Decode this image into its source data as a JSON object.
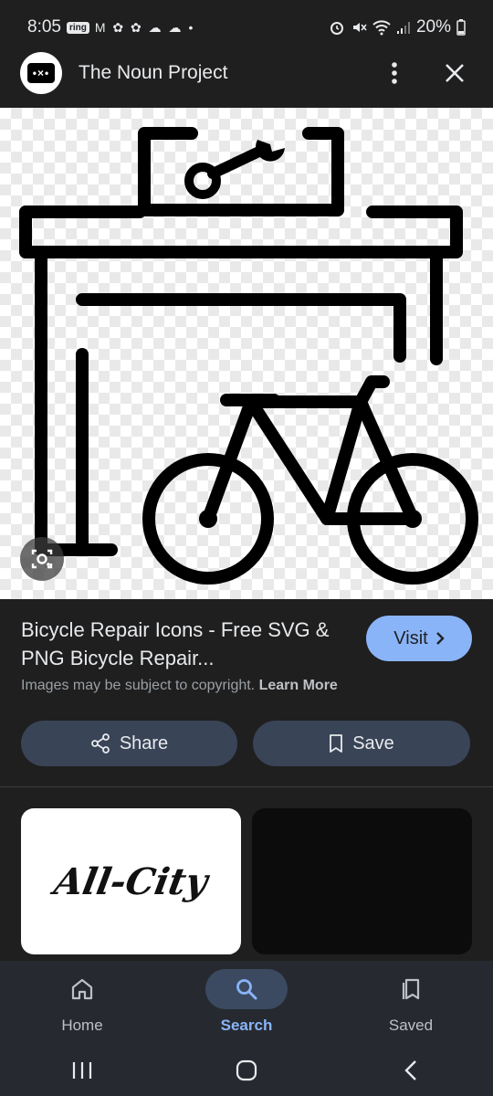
{
  "status_bar": {
    "time": "8:05",
    "notif_badge": "ring",
    "notif_icons": "M ✿ ✿ ☁ ☁ •",
    "battery": "20%"
  },
  "header": {
    "site_name": "The Noun Project",
    "logo_text": "•×•"
  },
  "result": {
    "title": "Bicycle Repair Icons - Free SVG & PNG Bicycle Repair...",
    "visit_label": "Visit",
    "copyright_text": "Images may be subject to copyright.",
    "learn_more": "Learn More",
    "share_label": "Share",
    "save_label": "Save"
  },
  "related": {
    "thumb1_text": "All-City"
  },
  "bottom_nav": {
    "items": [
      {
        "label": "Home",
        "icon": "home-icon"
      },
      {
        "label": "Search",
        "icon": "search-icon",
        "active": true
      },
      {
        "label": "Saved",
        "icon": "bookmarks-icon"
      }
    ]
  },
  "colors": {
    "accent": "#8ab4f8",
    "background": "#1f1f1f",
    "pill": "#394457"
  }
}
